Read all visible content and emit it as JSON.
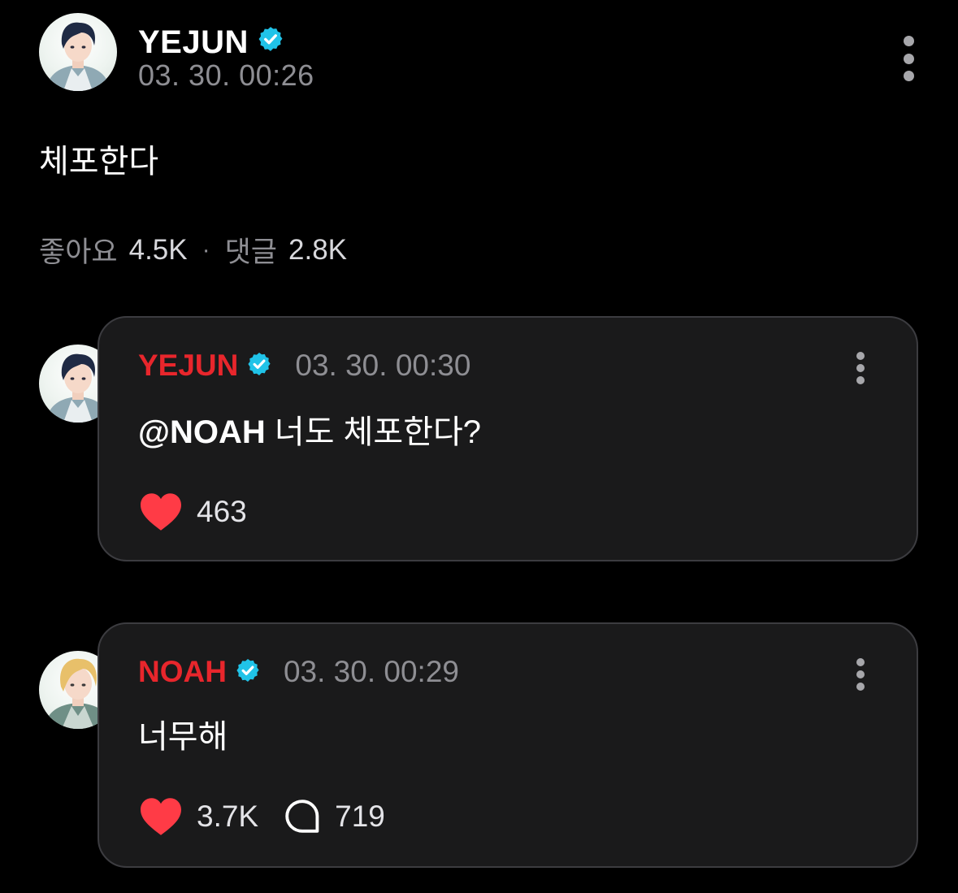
{
  "post": {
    "author": "YEJUN",
    "timestamp": "03. 30. 00:26",
    "body": "체포한다",
    "likes_label": "좋아요",
    "likes_count": "4.5K",
    "separator": "·",
    "comments_label": "댓글",
    "comments_count": "2.8K",
    "more_icon": "more-vertical-icon",
    "verified_icon": "verified-badge-icon"
  },
  "comments": [
    {
      "author": "YEJUN",
      "timestamp": "03. 30. 00:30",
      "mention": "@NOAH",
      "text": " 너도 체포한다?",
      "like_count": "463",
      "like_icon": "heart-icon",
      "more_icon": "more-vertical-icon"
    },
    {
      "author": "NOAH",
      "timestamp": "03. 30. 00:29",
      "text": "너무해",
      "like_count": "3.7K",
      "reply_count": "719",
      "like_icon": "heart-icon",
      "reply_icon": "speech-bubble-icon",
      "more_icon": "more-vertical-icon"
    }
  ],
  "colors": {
    "background": "#000000",
    "card": "#1a1a1b",
    "card_border": "#3c3c40",
    "author_accent": "#e8262c",
    "verified": "#20c3e8",
    "heart": "#ff3b46",
    "muted_text": "#8e8e93"
  }
}
